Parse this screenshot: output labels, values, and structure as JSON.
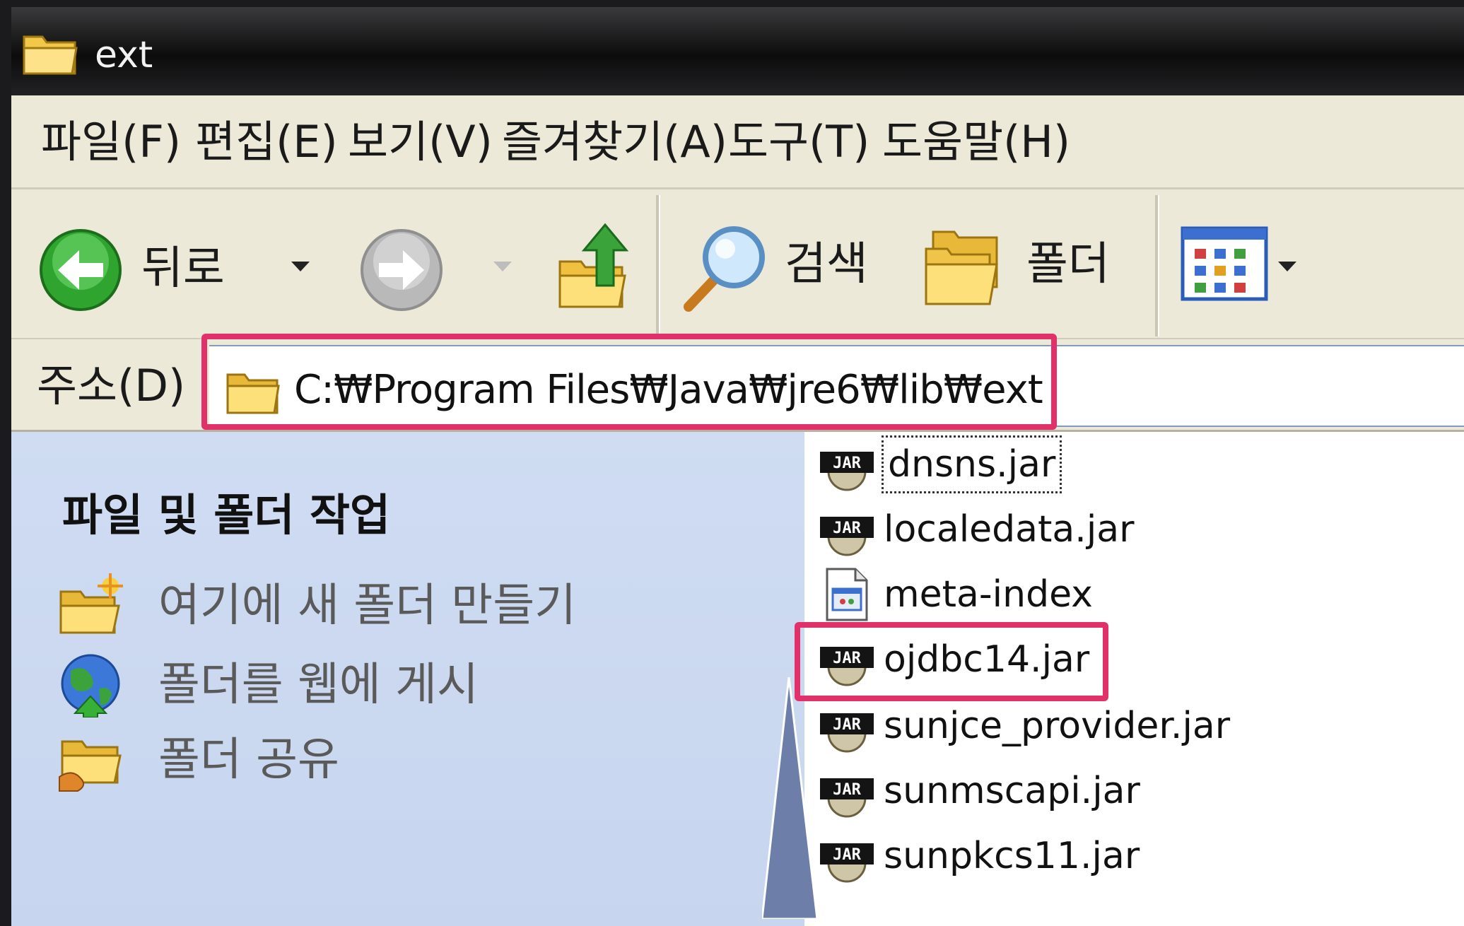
{
  "window": {
    "title": "ext"
  },
  "menu": [
    "파일(F)",
    "편집(E)",
    "보기(V)",
    "즐겨찾기(A)",
    "도구(T)",
    "도움말(H)"
  ],
  "toolbar": {
    "back_label": "뒤로",
    "search_label": "검색",
    "folders_label": "폴더"
  },
  "address": {
    "label": "주소(D)",
    "path": "C:₩Program Files₩Java₩jre6₩lib₩ext"
  },
  "tasks": {
    "title": "파일 및 폴더 작업",
    "items": [
      "여기에 새 폴더 만들기",
      "폴더를 웹에 게시",
      "폴더 공유"
    ]
  },
  "files": [
    {
      "name": "dnsns.jar",
      "icon": "jar-icon"
    },
    {
      "name": "localedata.jar",
      "icon": "jar-icon"
    },
    {
      "name": "meta-index",
      "icon": "generic-file-icon"
    },
    {
      "name": "ojdbc14.jar",
      "icon": "jar-icon"
    },
    {
      "name": "sunjce_provider.jar",
      "icon": "jar-icon"
    },
    {
      "name": "sunmscapi.jar",
      "icon": "jar-icon"
    },
    {
      "name": "sunpkcs11.jar",
      "icon": "jar-icon"
    }
  ],
  "colors": {
    "highlight": "#e2316a",
    "task_pane": "#cfdcf2",
    "title_bar": "#0c0c0d"
  }
}
